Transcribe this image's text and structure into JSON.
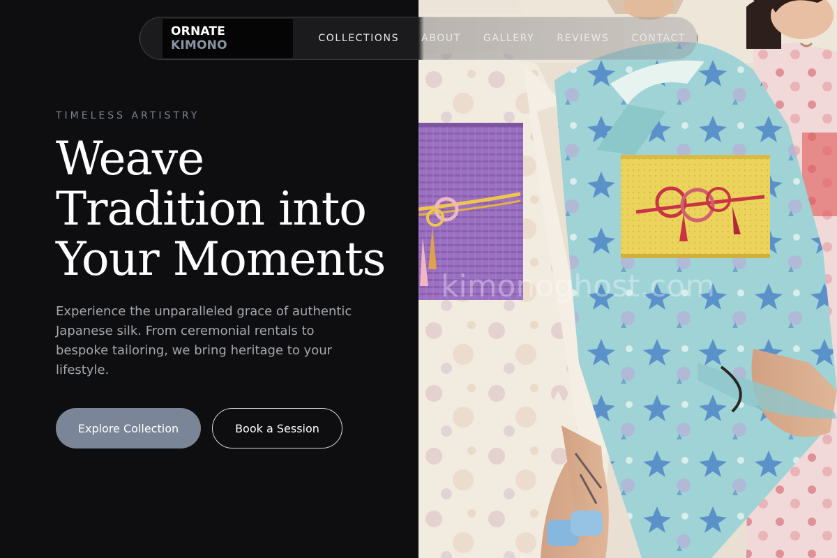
{
  "brand": {
    "primary": "ORNATE",
    "accent": "KIMONO"
  },
  "nav": {
    "items": [
      {
        "label": "COLLECTIONS"
      },
      {
        "label": "ABOUT"
      },
      {
        "label": "GALLERY"
      },
      {
        "label": "REVIEWS"
      },
      {
        "label": "CONTACT"
      }
    ]
  },
  "hero": {
    "eyebrow": "TIMELESS ARTISTRY",
    "headline_lines": [
      "Weave",
      "Tradition into",
      "Your Moments"
    ],
    "subtext": "Experience the unparalleled grace of authentic Japanese silk. From ceremonial rentals to bespoke tailoring, we bring heritage to your lifestyle.",
    "primary_button": "Explore Collection",
    "secondary_button": "Book a Session"
  },
  "photo": {
    "watermark": "kimonoghost.com",
    "subject_icon": "kimono-photo"
  },
  "colors": {
    "background": "#0e0e10",
    "accent": "#7a8698",
    "brand_accent": "#8a94a3",
    "text_muted": "#a4a8ae"
  }
}
